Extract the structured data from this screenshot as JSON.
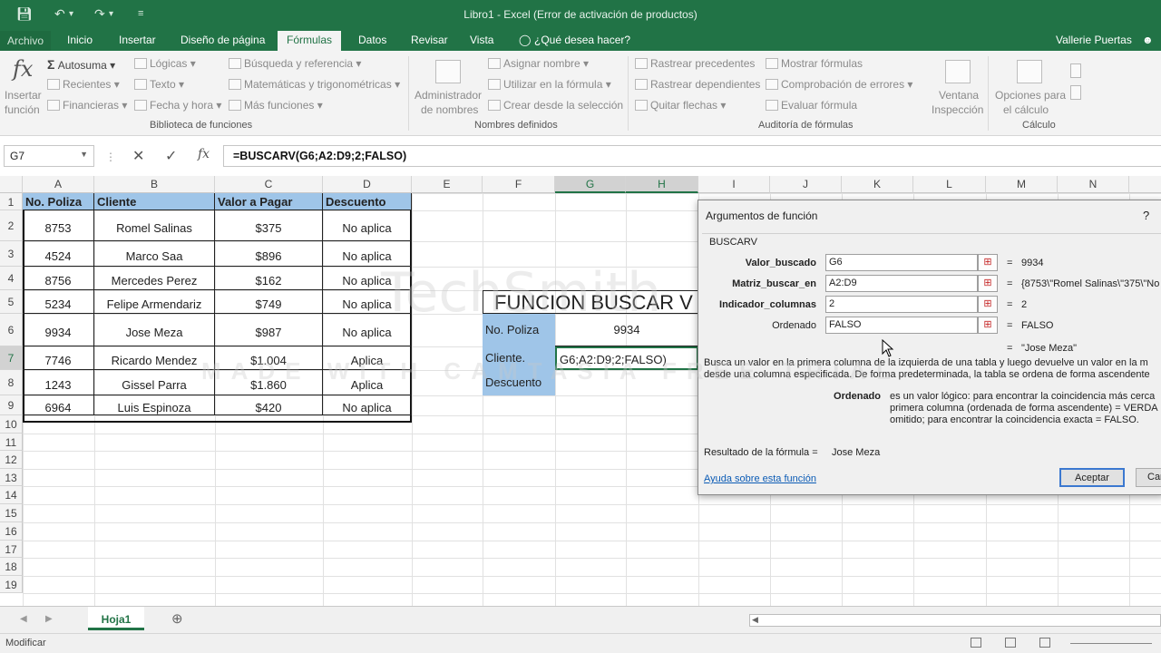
{
  "window": {
    "title": "Libro1 - Excel (Error de activación de productos)",
    "user": "Vallerie Puertas"
  },
  "tabs": [
    "Archivo",
    "Inicio",
    "Insertar",
    "Diseño de página",
    "Fórmulas",
    "Datos",
    "Revisar",
    "Vista"
  ],
  "tell_me": "¿Qué desea hacer?",
  "ribbon": {
    "insert_function": "Insertar",
    "insert_function2": "función",
    "autosum": "Autosuma",
    "recent": "Recientes",
    "financial": "Financieras",
    "logical": "Lógicas",
    "text": "Texto",
    "datetime": "Fecha y hora",
    "lookup": "Búsqueda y referencia",
    "math": "Matemáticas y trigonométricas",
    "more": "Más funciones",
    "group_library": "Biblioteca de funciones",
    "name_manager": "Administrador",
    "name_manager2": "de nombres",
    "define_name": "Asignar nombre",
    "use_in_formula": "Utilizar en la fórmula",
    "create_from_sel": "Crear desde la selección",
    "group_names": "Nombres definidos",
    "trace_prec": "Rastrear precedentes",
    "trace_dep": "Rastrear dependientes",
    "remove_arrows": "Quitar flechas",
    "show_formulas": "Mostrar fórmulas",
    "error_check": "Comprobación de errores",
    "eval_formula": "Evaluar fórmula",
    "watch_window": "Ventana",
    "watch_window2": "Inspección",
    "group_audit": "Auditoría de fórmulas",
    "calc_options": "Opciones para",
    "calc_options2": "el cálculo",
    "group_calc": "Cálculo"
  },
  "formula_bar": {
    "namebox": "G7",
    "formula": "=BUSCARV(G6;A2:D9;2;FALSO)"
  },
  "columns": [
    "A",
    "B",
    "C",
    "D",
    "E",
    "F",
    "G",
    "H",
    "I",
    "J",
    "K",
    "L",
    "M",
    "N"
  ],
  "rows": [
    "1",
    "2",
    "3",
    "4",
    "5",
    "6",
    "7",
    "8",
    "9",
    "10",
    "11",
    "12",
    "13",
    "14",
    "15",
    "16",
    "17",
    "18",
    "19"
  ],
  "table": {
    "headers": [
      "No. Poliza",
      "Cliente",
      "Valor a Pagar",
      "Descuento"
    ],
    "rows": [
      [
        "8753",
        "Romel Salinas",
        "$375",
        "No aplica"
      ],
      [
        "4524",
        "Marco Saa",
        "$896",
        "No aplica"
      ],
      [
        "8756",
        "Mercedes Perez",
        "$162",
        "No aplica"
      ],
      [
        "5234",
        "Felipe Armendariz",
        "$749",
        "No aplica"
      ],
      [
        "9934",
        "Jose Meza",
        "$987",
        "No aplica"
      ],
      [
        "7746",
        "Ricardo Mendez",
        "$1.004",
        "Aplica"
      ],
      [
        "1243",
        "Gissel Parra",
        "$1.860",
        "Aplica"
      ],
      [
        "6964",
        "Luis Espinoza",
        "$420",
        "No aplica"
      ]
    ]
  },
  "lookup_box": {
    "title": "FUNCION BUSCAR V",
    "label_poliza": "No. Poliza",
    "value_poliza": "9934",
    "label_cliente": "Cliente.",
    "value_cliente": "G6;A2:D9;2;FALSO)",
    "label_descuento": "Descuento"
  },
  "watermark": {
    "line1": "TechSmith",
    "line2": "MADE WITH CAMTASIA FREE TRIAL"
  },
  "dialog": {
    "title": "Argumentos de función",
    "help": "?",
    "func": "BUSCARV",
    "args": [
      {
        "label": "Valor_buscado",
        "value": "G6",
        "result": "9934"
      },
      {
        "label": "Matriz_buscar_en",
        "value": "A2:D9",
        "result": "{8753\\\"Romel Salinas\\\"375\\\"No"
      },
      {
        "label": "Indicador_columnas",
        "value": "2",
        "result": "2"
      },
      {
        "label": "Ordenado",
        "value": "FALSO",
        "result": "FALSO"
      }
    ],
    "eq": "=",
    "total_result": "\"Jose Meza\"",
    "desc1": "Busca un valor en la primera columna de la izquierda de una tabla y luego devuelve un valor en la m",
    "desc2": "desde una columna especificada. De forma predeterminada, la tabla se ordena de forma ascendente",
    "arg_name": "Ordenado",
    "arg_desc1": "es un valor lógico: para encontrar la coincidencia más cerca",
    "arg_desc2": "primera columna (ordenada de forma ascendente) = VERDA",
    "arg_desc3": "omitido; para encontrar la coincidencia exacta = FALSO.",
    "formula_result_label": "Resultado de la fórmula =",
    "formula_result": "Jose Meza",
    "help_link": "Ayuda sobre esta función",
    "ok": "Aceptar",
    "cancel": "Can"
  },
  "sheet_tab": "Hoja1",
  "status": "Modificar"
}
